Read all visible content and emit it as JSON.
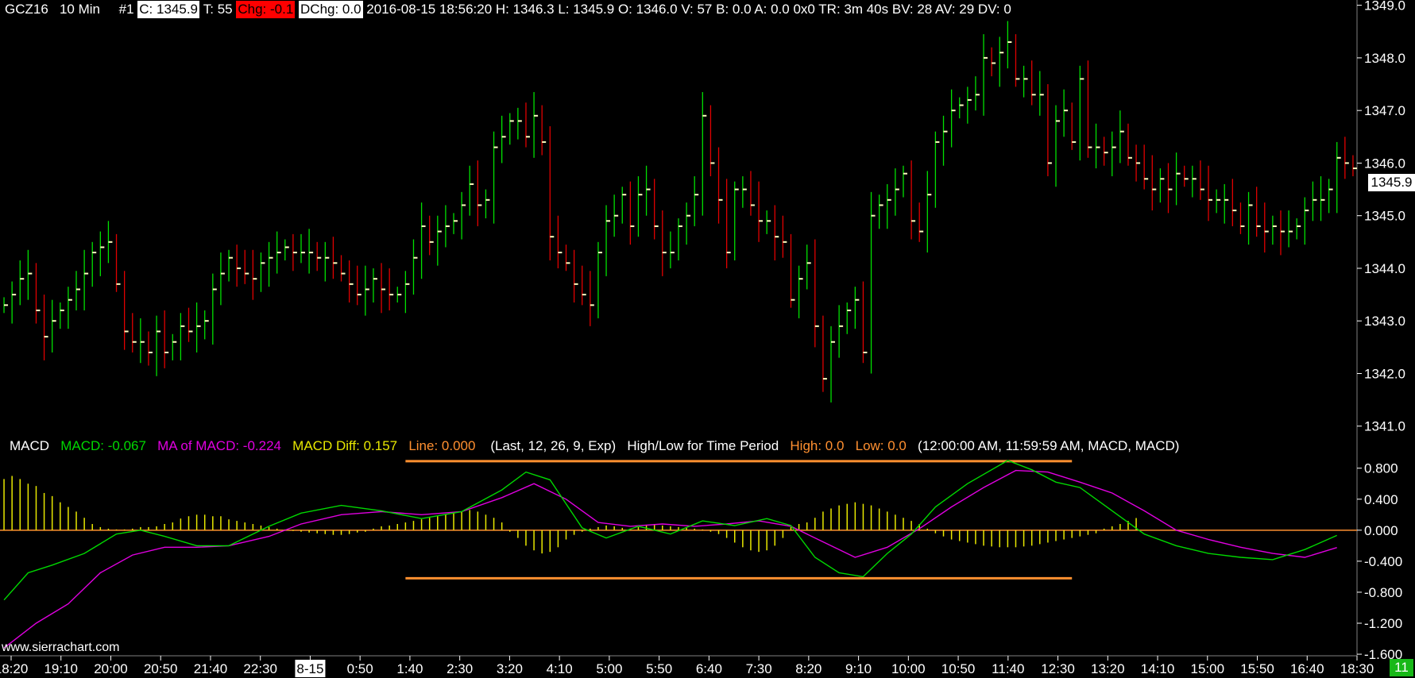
{
  "header": {
    "symbol": "GCZ16",
    "interval": "10 Min",
    "chart_number": "#1",
    "close": "C: 1345.9",
    "ticks": "T: 55",
    "change": "Chg: -0.1",
    "dchange": "DChg: 0.0",
    "info": "2016-08-15 18:56:20 H: 1346.3 L: 1345.9 O: 1346.0 V: 57 B: 0.0 A: 0.0 0x0 TR: 3m 40s BV: 28 AV: 29 DV: 0"
  },
  "macd_header": {
    "name": "MACD",
    "macd": "MACD: -0.067",
    "ma": "MA of MACD: -0.224",
    "diff": "MACD Diff: 0.157",
    "line": "Line: 0.000",
    "params": "(Last, 12, 26, 9, Exp)",
    "hl_label": "High/Low for Time Period",
    "high": "High: 0.0",
    "low": "Low: 0.0",
    "period": "(12:00:00 AM, 11:59:59 AM, MACD, MACD)"
  },
  "last_price_label": "1345.9",
  "watermark": "www.sierrachart.com",
  "bar_count_badge": "11",
  "colors": {
    "up": "#00e000",
    "down": "#e00000",
    "close_tick": "#ffffc0",
    "macd": "#00d800",
    "macd_ma": "#e000e0",
    "macd_diff": "#e8e800",
    "hl_line": "#ff9030",
    "axis_text": "#ffffff"
  },
  "chart_data": [
    {
      "type": "ohlc",
      "title": "GCZ16 10 Min",
      "x_tick_labels": [
        "18:20",
        "19:10",
        "20:00",
        "20:50",
        "21:40",
        "22:30",
        "8-15",
        "0:50",
        "1:40",
        "2:30",
        "3:20",
        "4:10",
        "5:00",
        "5:50",
        "6:40",
        "7:30",
        "8:20",
        "9:10",
        "10:00",
        "10:50",
        "11:40",
        "12:30",
        "13:20",
        "14:10",
        "15:00",
        "15:50",
        "16:40",
        "18:30"
      ],
      "y_ticks": [
        1341.0,
        1342.0,
        1343.0,
        1344.0,
        1345.0,
        1346.0,
        1347.0,
        1348.0,
        1349.0
      ],
      "ylim": [
        1340.8,
        1349.1
      ],
      "close": [
        1343.3,
        1343.5,
        1343.8,
        1343.9,
        1343.2,
        1342.7,
        1343.0,
        1343.2,
        1343.4,
        1343.6,
        1343.9,
        1344.3,
        1344.4,
        1344.5,
        1343.7,
        1342.8,
        1342.6,
        1342.6,
        1342.4,
        1342.8,
        1342.4,
        1342.6,
        1342.9,
        1342.8,
        1342.9,
        1343.0,
        1343.6,
        1343.9,
        1344.2,
        1344.0,
        1343.9,
        1343.8,
        1344.1,
        1344.2,
        1344.3,
        1344.4,
        1344.3,
        1344.3,
        1344.3,
        1344.2,
        1344.2,
        1344.1,
        1343.9,
        1343.7,
        1343.5,
        1343.6,
        1343.8,
        1343.6,
        1343.5,
        1343.5,
        1343.7,
        1344.2,
        1344.8,
        1344.5,
        1344.7,
        1344.8,
        1344.9,
        1345.2,
        1345.6,
        1345.2,
        1345.3,
        1346.3,
        1346.5,
        1346.8,
        1346.8,
        1346.5,
        1346.9,
        1346.4,
        1344.6,
        1344.3,
        1344.1,
        1343.7,
        1343.5,
        1343.3,
        1344.3,
        1344.9,
        1345.0,
        1345.4,
        1344.8,
        1345.4,
        1345.5,
        1344.8,
        1344.3,
        1344.3,
        1344.8,
        1345.0,
        1345.4,
        1346.9,
        1346.0,
        1345.3,
        1344.3,
        1345.5,
        1345.5,
        1345.2,
        1344.9,
        1344.9,
        1344.6,
        1344.5,
        1343.4,
        1343.8,
        1344.1,
        1342.9,
        1341.9,
        1342.6,
        1342.9,
        1343.2,
        1343.4,
        1342.4,
        1345.0,
        1345.2,
        1345.3,
        1345.5,
        1345.8,
        1344.9,
        1344.7,
        1345.4,
        1346.4,
        1346.6,
        1347.0,
        1347.1,
        1347.2,
        1347.3,
        1348.0,
        1347.9,
        1348.1,
        1348.3,
        1347.6,
        1347.6,
        1347.3,
        1347.3,
        1346.0,
        1346.8,
        1347.0,
        1346.4,
        1347.6,
        1346.3,
        1346.3,
        1346.2,
        1346.3,
        1346.6,
        1346.1,
        1346.0,
        1345.7,
        1345.5,
        1345.7,
        1345.5,
        1345.8,
        1345.7,
        1345.7,
        1345.5,
        1345.3,
        1345.3,
        1345.3,
        1345.1,
        1344.8,
        1345.2,
        1344.8,
        1344.7,
        1344.8,
        1344.7,
        1344.7,
        1344.8,
        1345.1,
        1345.3,
        1345.3,
        1345.5,
        1346.1,
        1346.0,
        1345.9
      ]
    },
    {
      "type": "line",
      "title": "MACD",
      "y_ticks": [
        -1.6,
        -1.2,
        -0.8,
        -0.4,
        0.0,
        0.4,
        0.8
      ],
      "ylim": [
        -1.62,
        0.92
      ],
      "series": [
        {
          "name": "MACD",
          "x": [
            0,
            3,
            6,
            10,
            14,
            17,
            20,
            24,
            28,
            33,
            37,
            42,
            47,
            52,
            57,
            62,
            65,
            68,
            72,
            75,
            79,
            83,
            87,
            91,
            95,
            98,
            101,
            104,
            107,
            110,
            113,
            116,
            120,
            125,
            128,
            131,
            134,
            138,
            142,
            146,
            150,
            154,
            158,
            162,
            166
          ],
          "values": [
            -0.9,
            -0.55,
            -0.45,
            -0.3,
            -0.05,
            0.0,
            -0.08,
            -0.2,
            -0.2,
            0.05,
            0.22,
            0.32,
            0.25,
            0.15,
            0.24,
            0.52,
            0.75,
            0.65,
            0.03,
            -0.1,
            0.05,
            -0.05,
            0.12,
            0.06,
            0.15,
            0.06,
            -0.35,
            -0.55,
            -0.6,
            -0.3,
            -0.05,
            0.3,
            0.6,
            0.9,
            0.78,
            0.62,
            0.55,
            0.25,
            -0.05,
            -0.2,
            -0.3,
            -0.35,
            -0.38,
            -0.25,
            -0.067
          ]
        },
        {
          "name": "MA of MACD",
          "x": [
            0,
            4,
            8,
            12,
            16,
            20,
            24,
            28,
            33,
            37,
            42,
            47,
            52,
            57,
            62,
            66,
            70,
            74,
            78,
            82,
            86,
            90,
            94,
            98,
            102,
            106,
            110,
            114,
            118,
            122,
            126,
            130,
            134,
            138,
            142,
            146,
            150,
            154,
            158,
            162,
            166
          ],
          "values": [
            -1.52,
            -1.2,
            -0.95,
            -0.55,
            -0.32,
            -0.22,
            -0.22,
            -0.2,
            -0.08,
            0.08,
            0.2,
            0.24,
            0.2,
            0.24,
            0.42,
            0.6,
            0.4,
            0.1,
            0.05,
            0.08,
            0.05,
            0.08,
            0.12,
            0.05,
            -0.15,
            -0.35,
            -0.22,
            0.02,
            0.3,
            0.55,
            0.77,
            0.75,
            0.62,
            0.48,
            0.25,
            0.0,
            -0.12,
            -0.22,
            -0.3,
            -0.35,
            -0.224
          ]
        },
        {
          "name": "MACD Diff",
          "type": "bar",
          "x_start": 0,
          "values": [
            0.66,
            0.7,
            0.66,
            0.6,
            0.57,
            0.48,
            0.44,
            0.36,
            0.3,
            0.24,
            0.16,
            0.08,
            0.04,
            0.02,
            0.01,
            0.01,
            0.02,
            0.04,
            0.04,
            0.05,
            0.08,
            0.1,
            0.15,
            0.18,
            0.2,
            0.2,
            0.18,
            0.18,
            0.14,
            0.12,
            0.1,
            0.08,
            0.06,
            0.04,
            0.02,
            0.01,
            -0.01,
            -0.02,
            -0.03,
            -0.04,
            -0.05,
            -0.06,
            -0.06,
            -0.05,
            -0.03,
            -0.02,
            0.02,
            0.05,
            0.06,
            0.08,
            0.1,
            0.12,
            0.14,
            0.16,
            0.18,
            0.2,
            0.22,
            0.24,
            0.26,
            0.24,
            0.2,
            0.16,
            0.1,
            -0.02,
            -0.1,
            -0.2,
            -0.26,
            -0.3,
            -0.28,
            -0.22,
            -0.12,
            -0.06,
            -0.02,
            0.02,
            0.04,
            0.06,
            0.05,
            0.03,
            0.02,
            0.04,
            0.06,
            0.08,
            0.06,
            0.05,
            0.04,
            0.03,
            0.02,
            0.01,
            -0.02,
            -0.05,
            -0.1,
            -0.16,
            -0.22,
            -0.26,
            -0.28,
            -0.26,
            -0.2,
            -0.1,
            0.04,
            0.08,
            0.1,
            0.16,
            0.24,
            0.28,
            0.32,
            0.34,
            0.36,
            0.34,
            0.32,
            0.28,
            0.24,
            0.2,
            0.16,
            0.12,
            0.08,
            0.02,
            -0.04,
            -0.08,
            -0.12,
            -0.14,
            -0.16,
            -0.18,
            -0.2,
            -0.21,
            -0.22,
            -0.22,
            -0.22,
            -0.21,
            -0.2,
            -0.18,
            -0.16,
            -0.14,
            -0.12,
            -0.1,
            -0.08,
            -0.06,
            -0.04,
            0.02,
            0.05,
            0.08,
            0.12,
            0.157
          ]
        },
        {
          "name": "Line",
          "values": [
            0.0
          ]
        }
      ],
      "high_low_lines": {
        "high": 0.89,
        "low": -0.62,
        "from_bar": 50,
        "to_bar": 133
      }
    }
  ]
}
